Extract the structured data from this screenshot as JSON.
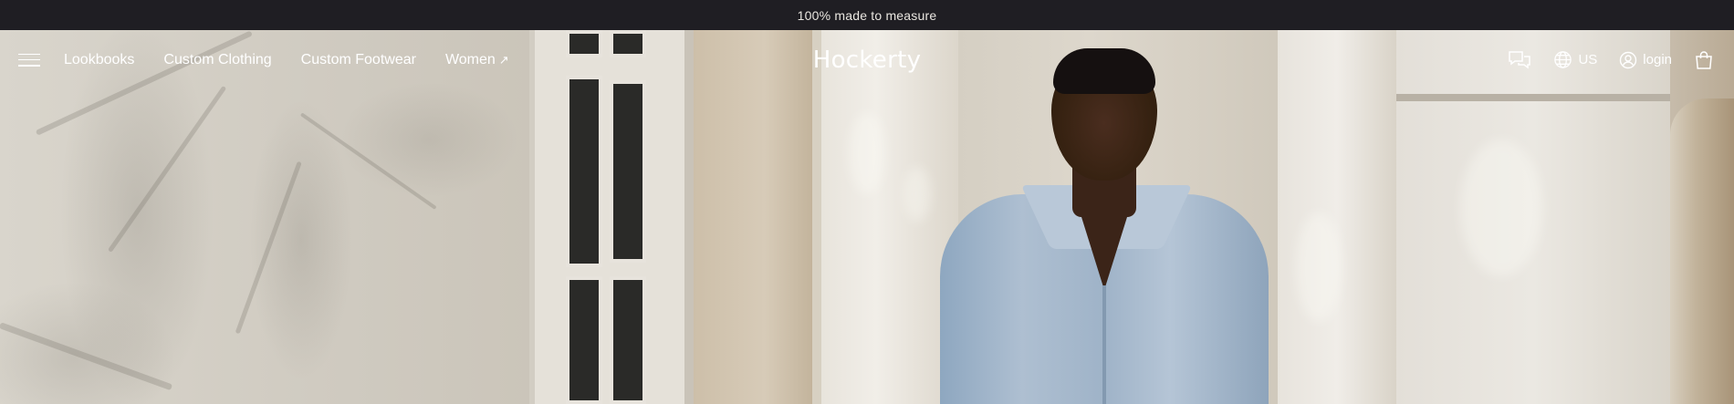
{
  "announcement": "100% made to measure",
  "nav": {
    "links": [
      "Lookbooks",
      "Custom Clothing",
      "Custom Footwear",
      "Women"
    ],
    "women_arrow": "↗"
  },
  "logo": "Hockerty",
  "utility": {
    "region": "US",
    "login": "login"
  },
  "icons": [
    "menu-icon",
    "chat-icon",
    "globe-icon",
    "user-icon",
    "shopping-bag-icon",
    "external-arrow-icon"
  ],
  "colors": {
    "announcement_bg": "#1f1e23",
    "nav_text": "#ffffff"
  }
}
